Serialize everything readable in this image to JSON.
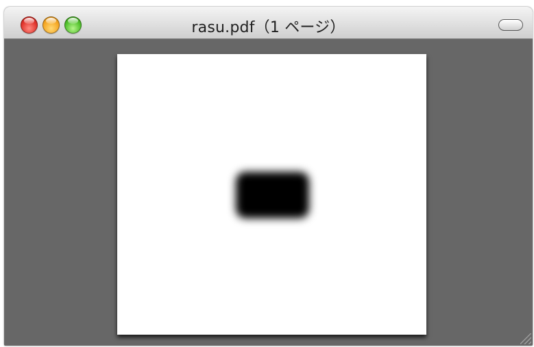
{
  "window": {
    "title": "rasu.pdf（1 ページ）"
  },
  "titlebar": {
    "buttons": [
      {
        "name": "close",
        "icon": "close-icon",
        "color": "#e0332b"
      },
      {
        "name": "minimize",
        "icon": "minimize-icon",
        "color": "#f5a623"
      },
      {
        "name": "zoom",
        "icon": "zoom-icon",
        "color": "#4fbf2a"
      }
    ],
    "toolbar_toggle_icon": "toolbar-toggle-icon"
  },
  "document": {
    "page_count": 1,
    "background_color": "#676767",
    "page_color": "#ffffff",
    "shape": "blurred black rounded rectangle"
  }
}
